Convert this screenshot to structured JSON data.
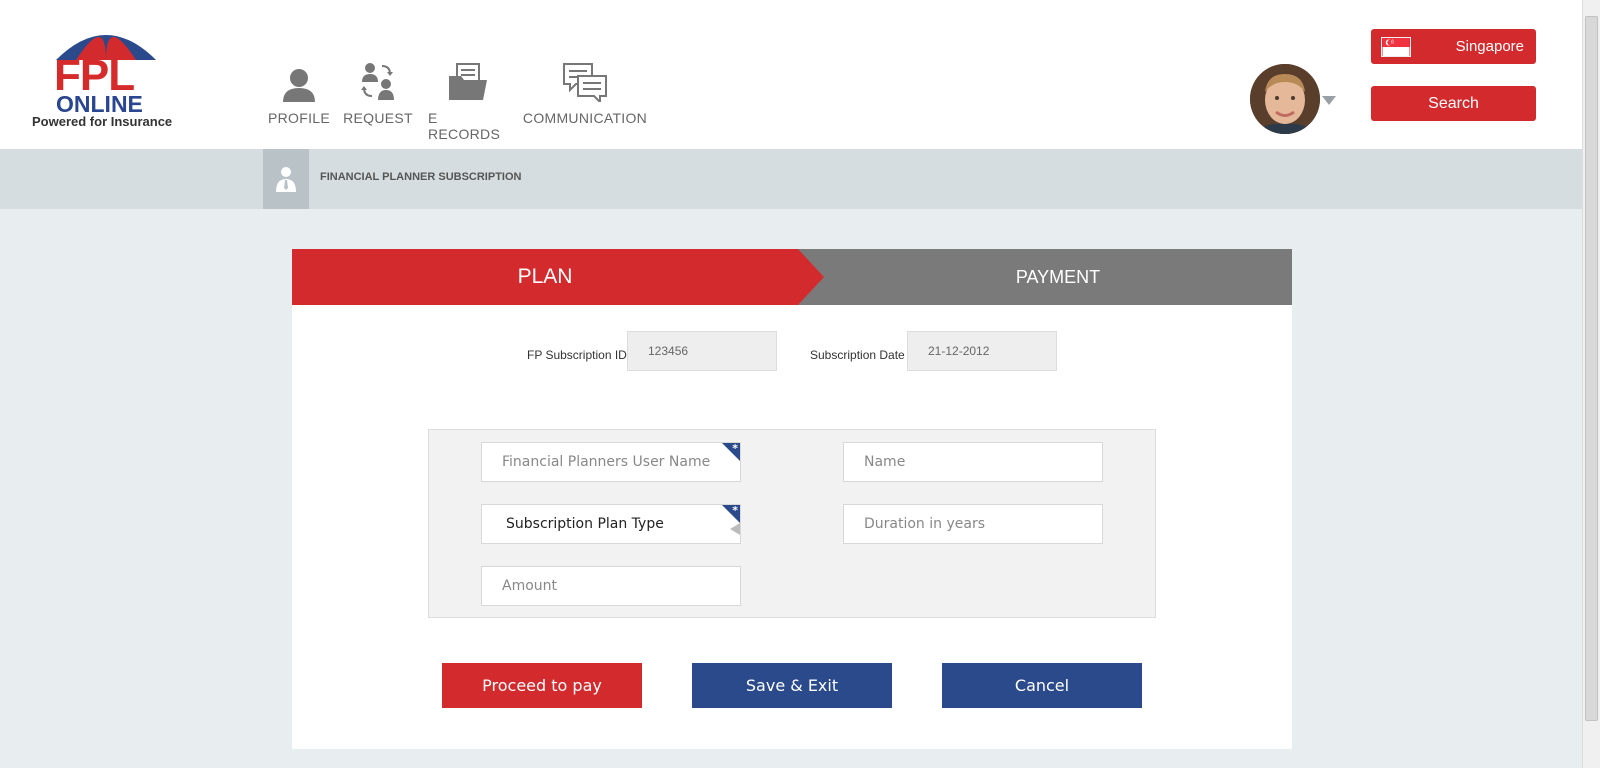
{
  "logo": {
    "title": "FPL",
    "subtitle": "ONLINE",
    "tagline": "Powered for Insurance"
  },
  "nav": [
    {
      "label": "PROFILE",
      "icon": "person-icon"
    },
    {
      "label": "REQUEST",
      "icon": "people-exchange-icon"
    },
    {
      "label": "E RECORDS",
      "icon": "folder-icon"
    },
    {
      "label": "COMMUNICATION",
      "icon": "chat-bubbles-icon"
    }
  ],
  "header": {
    "country": "Singapore",
    "search_label": "Search"
  },
  "breadcrumb": {
    "title": "FINANCIAL PLANNER SUBSCRIPTION"
  },
  "steps": {
    "plan": "PLAN",
    "payment": "PAYMENT",
    "active": "PLAN"
  },
  "meta": {
    "id_label": "FP Subscription ID",
    "id_value": "123456",
    "date_label": "Subscription Date",
    "date_value": "21-12-2012"
  },
  "form": {
    "username_placeholder": "Financial Planners User Name",
    "name_placeholder": "Name",
    "plan_type_value": "Subscription Plan Type",
    "duration_placeholder": "Duration in years",
    "amount_placeholder": "Amount"
  },
  "buttons": {
    "proceed": "Proceed to pay",
    "save": "Save & Exit",
    "cancel": "Cancel"
  },
  "colors": {
    "brand_red": "#d32a2e",
    "brand_blue": "#2b4a8c",
    "step_gray": "#7a7a7a"
  }
}
